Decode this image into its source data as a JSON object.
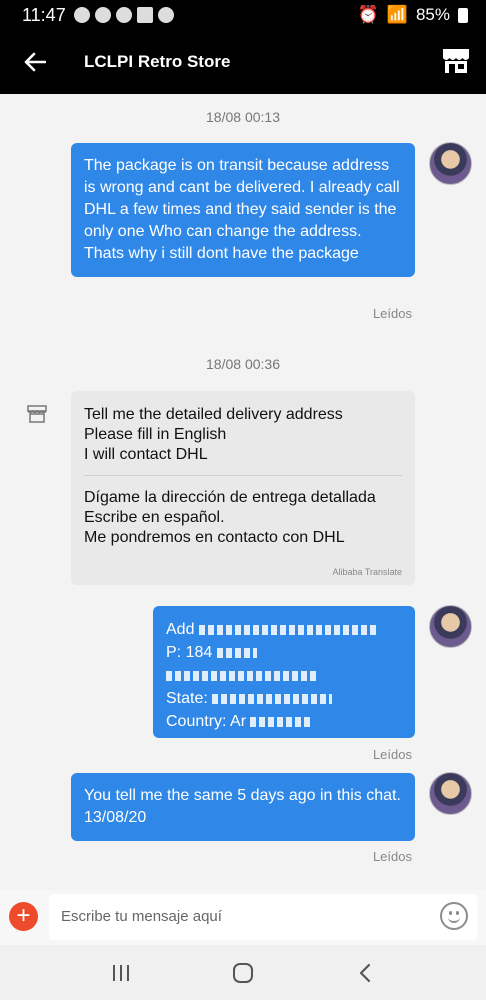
{
  "status_bar": {
    "time": "11:47",
    "battery": "85%"
  },
  "header": {
    "title": "LCLPI Retro Store",
    "back_icon": "back-arrow-icon",
    "store_icon": "store-icon"
  },
  "messages": {
    "stamp1": "18/08 00:13",
    "msg1": "The package is on transit because address is wrong and cant be delivered. I already call DHL a few times and they said sender is the only one Who can change the address. Thats why i still dont have the package",
    "read1": "Leídos",
    "stamp2": "18/08 00:36",
    "msg2": {
      "line1": "Tell me the detailed delivery address",
      "line2": "Please fill in English",
      "line3": "I will contact DHL",
      "tline1": "Dígame la dirección de entrega detallada",
      "tline2": "Escribe en español.",
      "tline3": "Me pondremos en contacto con DHL",
      "credit": "Alibaba Translate"
    },
    "msg3": {
      "line1": "Add",
      "line2": "P: 184",
      "line4": "State:",
      "line5": "Country: Ar"
    },
    "read3": "Leídos",
    "msg4": "You tell me the same 5 days ago in this chat. 13/08/20",
    "read4": "Leídos"
  },
  "composer": {
    "placeholder": "Escribe tu mensaje aquí",
    "plus_label": "+"
  },
  "navigation": {
    "recent_icon": "recent-apps-icon",
    "home_icon": "home-icon",
    "back_icon": "back-icon"
  },
  "colors": {
    "outgoing_bubble": "#2f87e8",
    "incoming_bubble": "#e9e9e9",
    "header": "#000000",
    "plus_button": "#ee4a2c"
  }
}
